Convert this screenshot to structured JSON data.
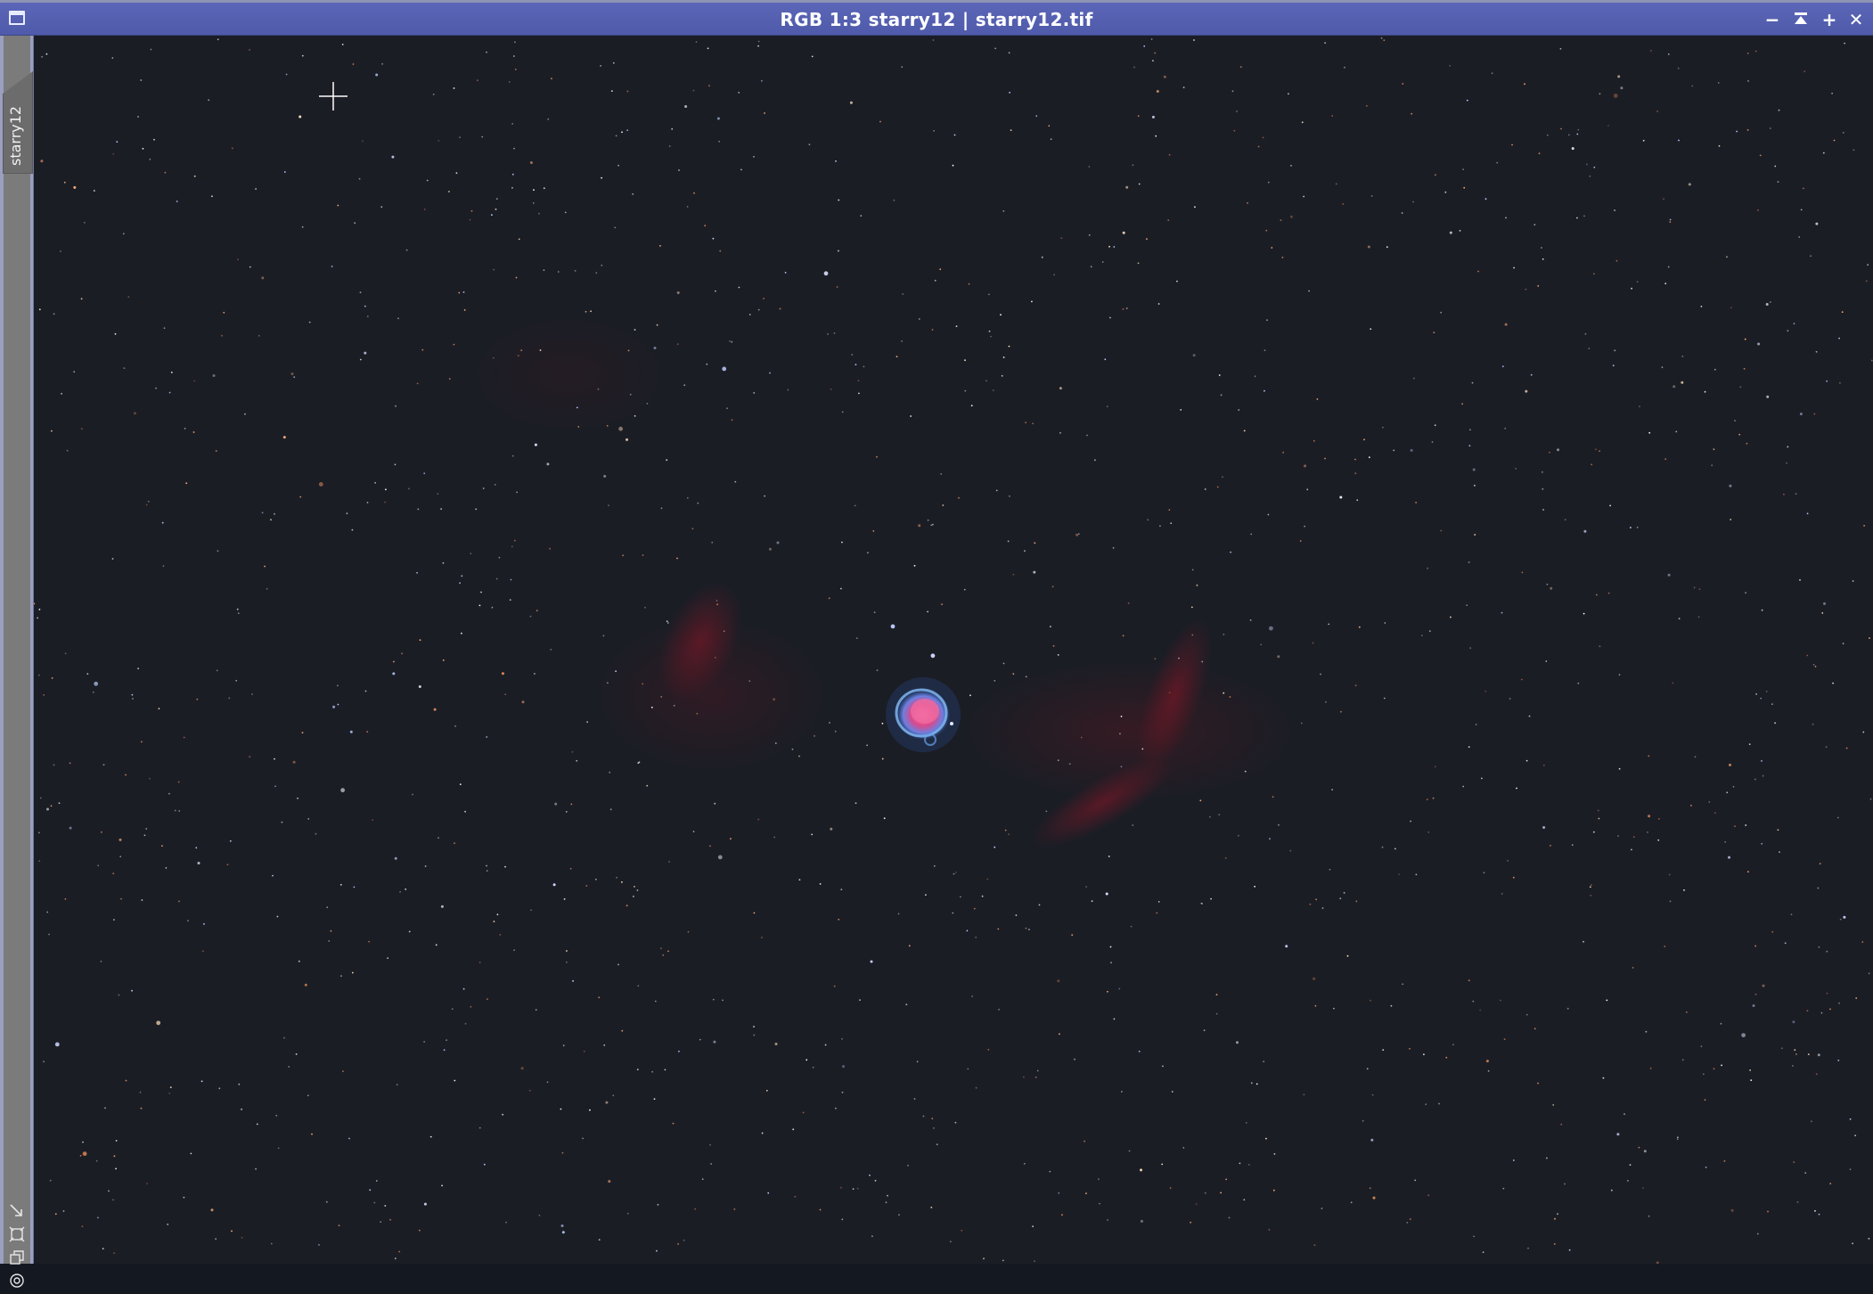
{
  "window": {
    "title": "RGB 1:3 starry12 | starry12.tif",
    "buttons": {
      "minimize": "−",
      "shade": "⌅",
      "maximize": "+",
      "close": "✕"
    }
  },
  "side_tab": {
    "label": "starry12"
  },
  "side_icons": [
    "resize-corner-icon",
    "fit-view-icon",
    "clone-icon",
    "identifier-icon"
  ],
  "colors": {
    "titlebar": "#5360b0",
    "sky": "#1b1d25",
    "nebula_pink": "#e0508a",
    "nebula_blue": "#5ea8e8",
    "hydrogen_red": "#7a1422"
  }
}
